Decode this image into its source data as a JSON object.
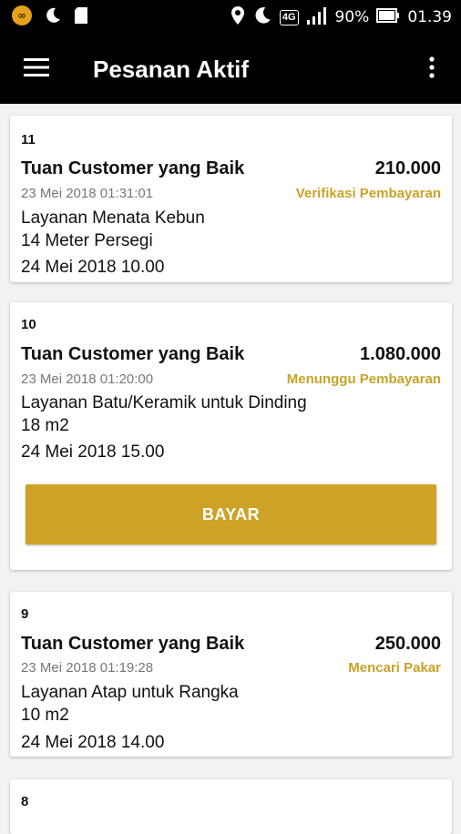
{
  "status_bar": {
    "battery": "90%",
    "time": "01.39",
    "network": "4G"
  },
  "app_bar": {
    "title": "Pesanan Aktif"
  },
  "orders": [
    {
      "id": "11",
      "customer": "Tuan Customer yang Baik",
      "price": "210.000",
      "created": "23 Mei 2018 01:31:01",
      "status": "Verifikasi Pembayaran",
      "service": "Layanan Menata Kebun",
      "size": "14 Meter Persegi",
      "schedule": "24 Mei 2018 10.00"
    },
    {
      "id": "10",
      "customer": "Tuan Customer yang Baik",
      "price": "1.080.000",
      "created": "23 Mei 2018 01:20:00",
      "status": "Menunggu Pembayaran",
      "service": "Layanan Batu/Keramik untuk Dinding",
      "size": "18 m2",
      "schedule": "24 Mei 2018 15.00",
      "button": "BAYAR"
    },
    {
      "id": "9",
      "customer": "Tuan Customer yang Baik",
      "price": "250.000",
      "created": "23 Mei 2018 01:19:28",
      "status": "Mencari Pakar",
      "service": "Layanan Atap untuk Rangka",
      "size": "10 m2",
      "schedule": "24 Mei 2018 14.00"
    },
    {
      "id": "8"
    }
  ],
  "colors": {
    "accent": "#cda227",
    "status_text": "#c9a227"
  }
}
